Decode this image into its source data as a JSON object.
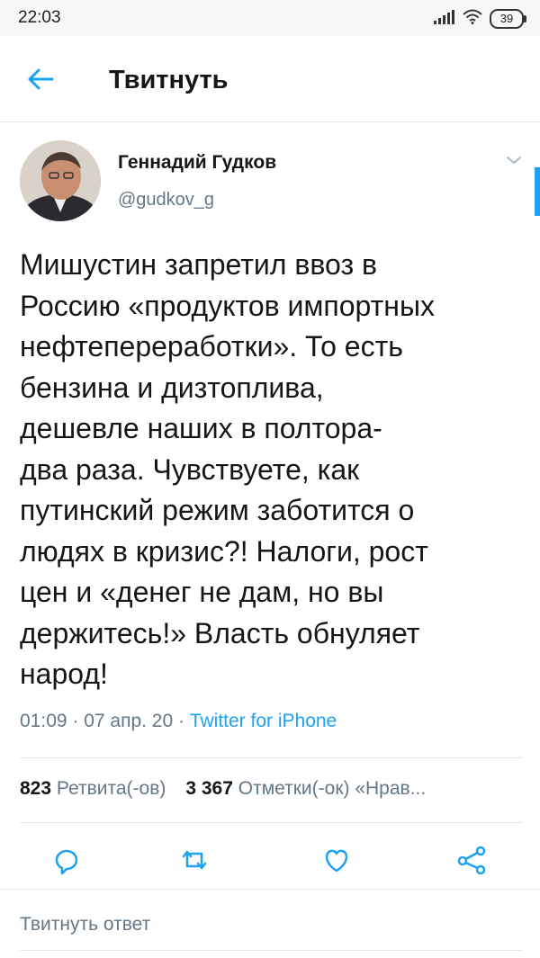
{
  "status_bar": {
    "time": "22:03",
    "battery": "39"
  },
  "header": {
    "title": "Твитнуть"
  },
  "tweet": {
    "author_name": "Геннадий Гудков",
    "author_handle": "@gudkov_g",
    "text": "Мишустин запретил ввоз в\nРоссию «продуктов импортных\nнефтепереработки». То есть\nбензина и дизтоплива,\nдешевле наших в полтора-\nдва раза. Чувствуете, как\nпутинский режим заботится о\nлюдях в кризис?! Налоги, рост\nцен и «денег не дам, но вы\nдержитесь!» Власть обнуляет\nнарод!",
    "timestamp": "01:09 · 07 апр. 20 · ",
    "source": "Twitter for iPhone"
  },
  "stats": {
    "retweets_count": "823",
    "retweets_label": "Ретвита(-ов)",
    "likes_count": "3 367",
    "likes_label": "Отметки(-ок) «Нрав..."
  },
  "actions": {
    "icons": [
      "reply-icon",
      "retweet-icon",
      "like-icon",
      "share-icon"
    ]
  },
  "reply": {
    "placeholder": "Твитнуть ответ"
  },
  "colors": {
    "accent": "#1da1f2",
    "text": "#14171a",
    "secondary": "#657786",
    "divider": "#e1e8ed"
  }
}
